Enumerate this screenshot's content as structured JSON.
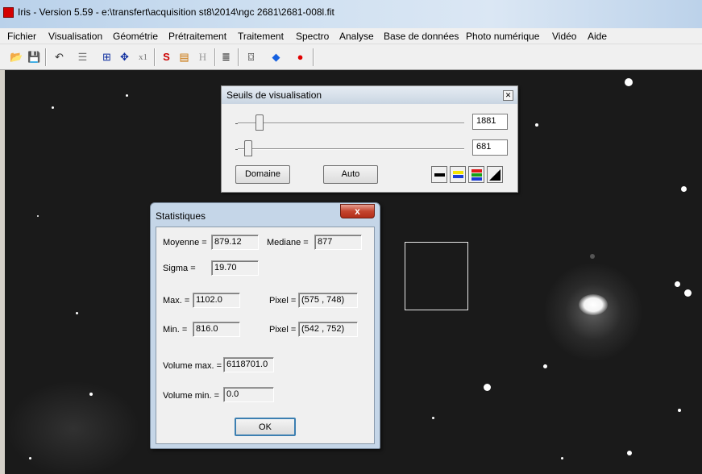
{
  "window": {
    "title": "Iris - Version 5.59 - e:\\transfert\\acquisition st8\\2014\\ngc 2681\\2681-008l.fit"
  },
  "menu": [
    "Fichier",
    "Visualisation",
    "Géométrie",
    "Prétraitement",
    "Traitement",
    "Spectro",
    "Analyse",
    "Base de données",
    "Photo numérique",
    "Vidéo",
    "Aide"
  ],
  "toolbar": {
    "buttons": [
      {
        "name": "open-icon",
        "glyph": "📂"
      },
      {
        "name": "save-icon",
        "glyph": "💾"
      },
      {
        "name": "undo-icon",
        "glyph": "↶"
      },
      {
        "name": "threshold-icon",
        "glyph": "☰"
      },
      {
        "name": "zoom-fit-icon",
        "glyph": "⊞"
      },
      {
        "name": "move-icon",
        "glyph": "✥"
      },
      {
        "name": "zoom-x1-icon",
        "glyph": "x1"
      },
      {
        "name": "tool-s-icon",
        "glyph": "S"
      },
      {
        "name": "palette-icon",
        "glyph": "▤"
      },
      {
        "name": "header-icon",
        "glyph": "H"
      },
      {
        "name": "list-icon",
        "glyph": "≣"
      },
      {
        "name": "camera-icon",
        "glyph": "⌼"
      },
      {
        "name": "star-tool-icon",
        "glyph": "◆"
      },
      {
        "name": "record-icon",
        "glyph": "●"
      }
    ]
  },
  "seuils": {
    "title": "Seuils de visualisation",
    "high_value": "1881",
    "low_value": "681",
    "high_level": 0.08,
    "low_level": 0.03,
    "domaine_label": "Domaine",
    "auto_label": "Auto",
    "colors": {
      "yellow": "#f5e400",
      "blue": "#1a3cd6",
      "red": "#e01818",
      "green": "#18a018"
    }
  },
  "stats": {
    "title": "Statistiques",
    "close_glyph": "x",
    "moyenne_label": "Moyenne =",
    "moyenne_value": "879.12",
    "mediane_label": "Mediane =",
    "mediane_value": "877",
    "sigma_label": "Sigma =",
    "sigma_value": "19.70",
    "max_label": "Max. =",
    "max_value": "1102.0",
    "pixel_max_label": "Pixel =",
    "pixel_max_value": "(575 , 748)",
    "min_label": "Min. =",
    "min_value": "816.0",
    "pixel_min_label": "Pixel =",
    "pixel_min_value": "(542 , 752)",
    "volmax_label": "Volume max. =",
    "volmax_value": "6118701.0",
    "volmin_label": "Volume min. =",
    "volmin_value": "0.0",
    "ok_label": "OK"
  }
}
